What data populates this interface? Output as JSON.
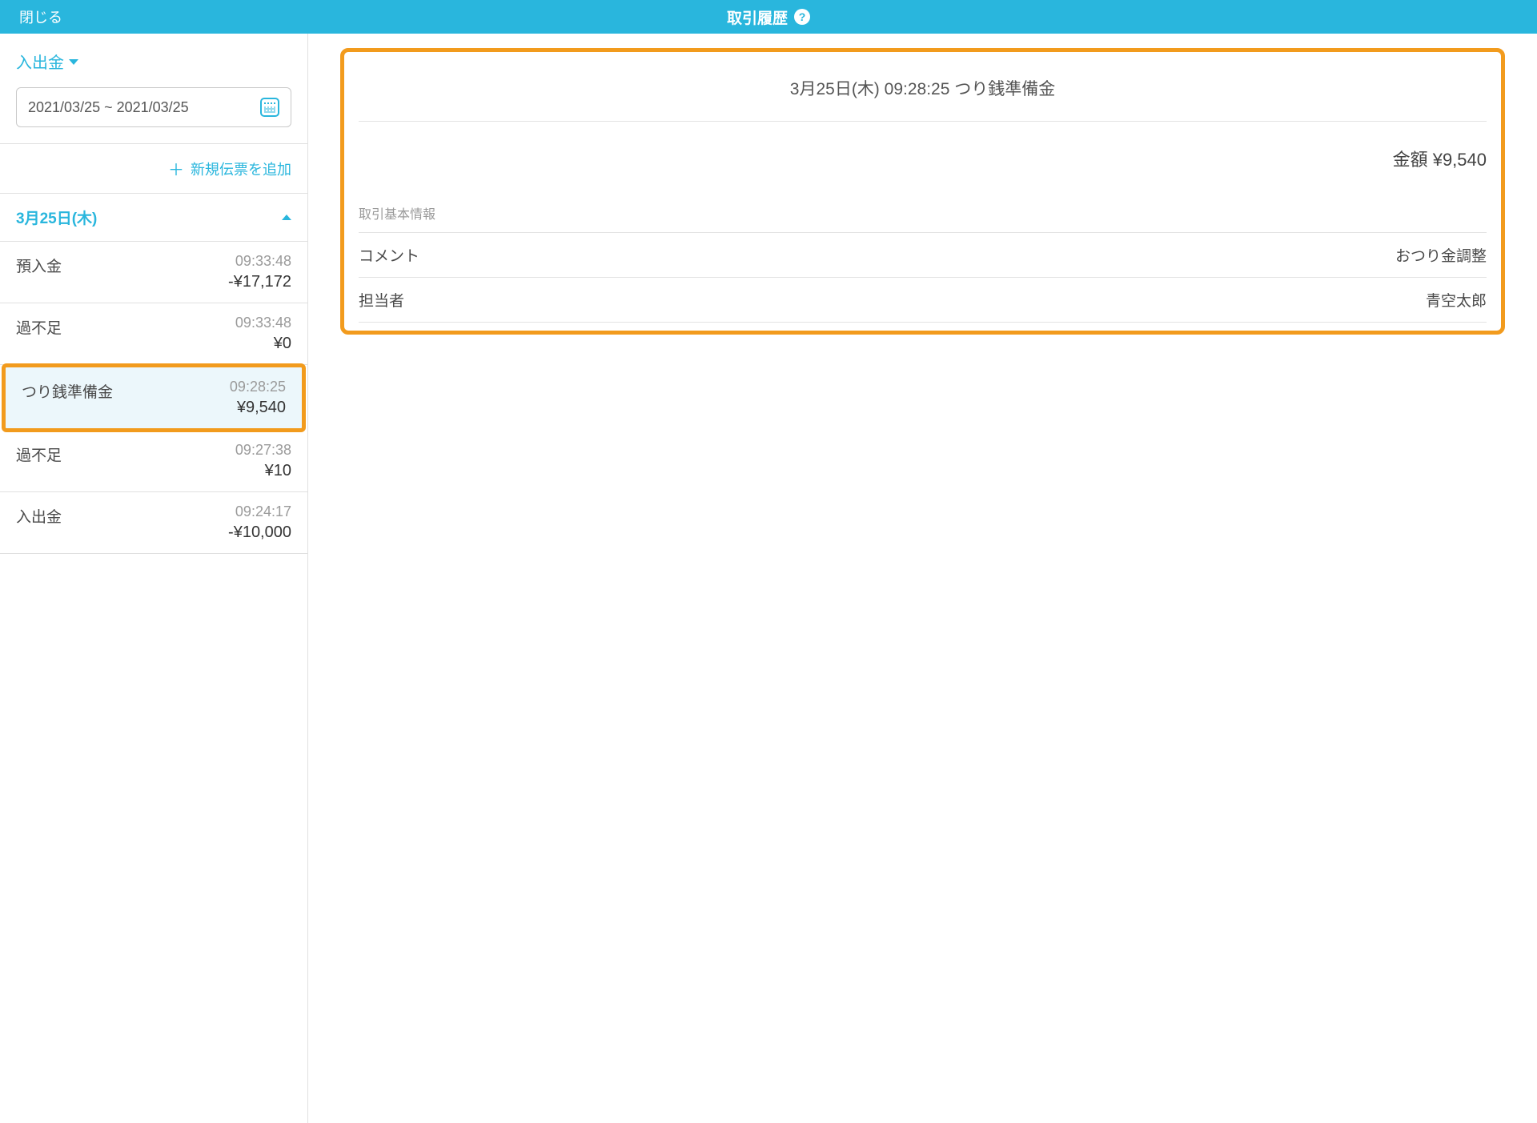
{
  "header": {
    "close_label": "閉じる",
    "title": "取引履歴"
  },
  "sidebar": {
    "filter_label": "入出金",
    "date_range": "2021/03/25 ~ 2021/03/25",
    "add_label": "新規伝票を追加",
    "date_header": "3月25日(木)",
    "items": [
      {
        "label": "預入金",
        "time": "09:33:48",
        "amount": "-¥17,172",
        "selected": false
      },
      {
        "label": "過不足",
        "time": "09:33:48",
        "amount": "¥0",
        "selected": false
      },
      {
        "label": "つり銭準備金",
        "time": "09:28:25",
        "amount": "¥9,540",
        "selected": true
      },
      {
        "label": "過不足",
        "time": "09:27:38",
        "amount": "¥10",
        "selected": false
      },
      {
        "label": "入出金",
        "time": "09:24:17",
        "amount": "-¥10,000",
        "selected": false
      }
    ]
  },
  "detail": {
    "title": "3月25日(木) 09:28:25 つり銭準備金",
    "amount_label": "金額 ¥9,540",
    "section_label": "取引基本情報",
    "comment_label": "コメント",
    "comment_value": "おつり金調整",
    "staff_label": "担当者",
    "staff_value": "青空太郎"
  }
}
